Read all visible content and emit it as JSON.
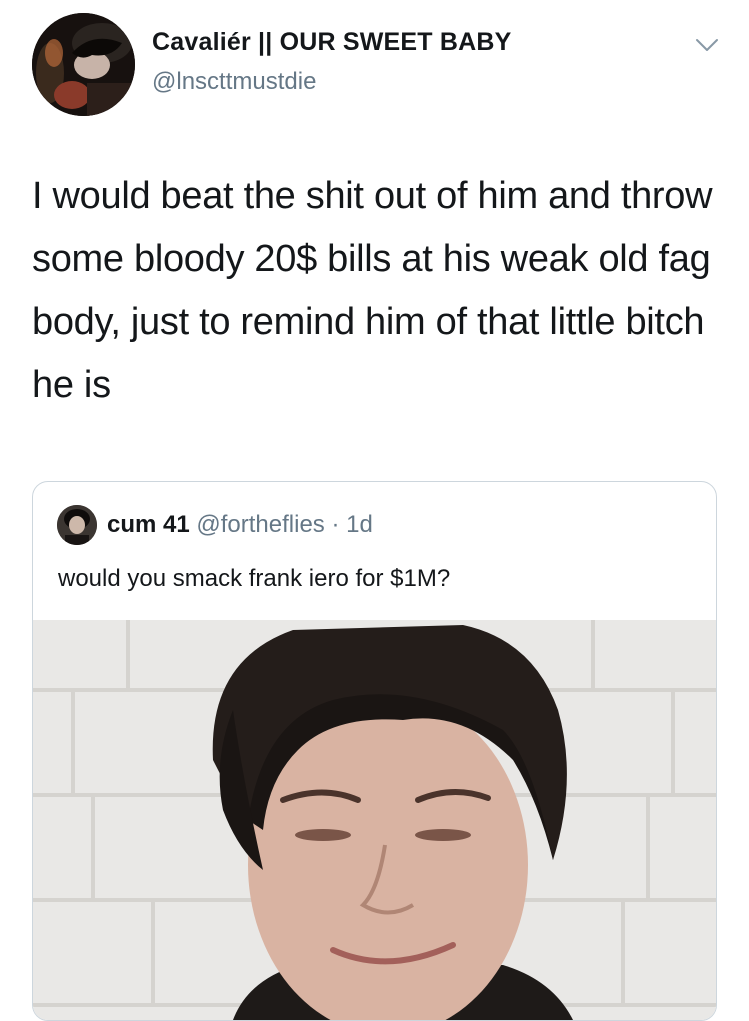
{
  "tweet": {
    "display_name": "Cavaliér || OUR SWEET BABY",
    "handle": "@lnscttmustdie",
    "text": "I would beat the shit out of him and throw some bloody 20$ bills at his weak old fag body, just to remind him of that little bitch he is",
    "menu_icon": "chevron-down-icon"
  },
  "quoted_tweet": {
    "display_name": "cum 41",
    "handle": "@fortheflies",
    "separator": " · ",
    "time": "1d",
    "text": "would you smack frank iero for $1M?"
  },
  "colors": {
    "text": "#14171a",
    "secondary_text": "#657786",
    "border": "#cdd6dd"
  }
}
